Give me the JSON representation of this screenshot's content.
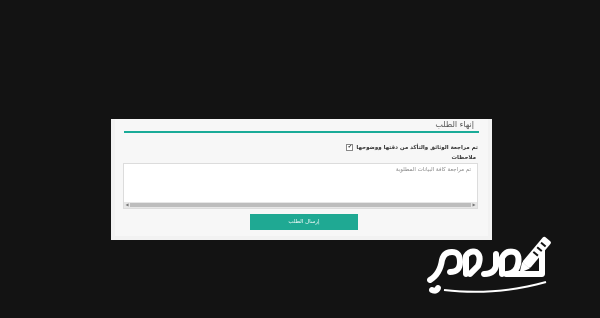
{
  "form": {
    "section_title": "إنهاء الطلب",
    "confirm_label": "تم مراجعة الوثائق والتأكد من دقتها ووضوحها",
    "confirm_checked": true,
    "notes_label": "ملاحظات",
    "notes_value": "تم مراجعة كافة البيانات المطلوبة",
    "submit_label": "إرسال الطلب"
  },
  "logo": {
    "text": "محتوى"
  },
  "colors": {
    "accent": "#1fa993",
    "background": "#131313",
    "panel": "#f7f7f7"
  }
}
